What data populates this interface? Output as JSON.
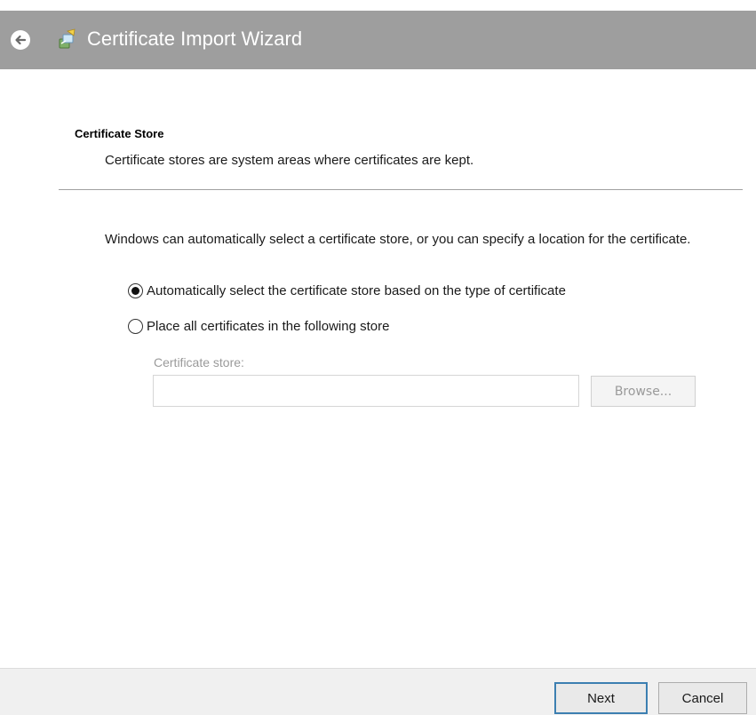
{
  "window": {
    "title": "Certificate Import Wizard",
    "back_icon": "back-arrow-icon",
    "app_icon": "certificate-wizard-icon"
  },
  "header": {
    "section_title": "Certificate Store",
    "section_description": "Certificate stores are system areas where certificates are kept."
  },
  "body": {
    "intro": "Windows can automatically select a certificate store, or you can specify a location for the certificate.",
    "options": [
      {
        "label": "Automatically select the certificate store based on the type of certificate",
        "selected": true
      },
      {
        "label": "Place all certificates in the following store",
        "selected": false
      }
    ],
    "store_label": "Certificate store:",
    "store_value": "",
    "browse_label": "Browse..."
  },
  "footer": {
    "next_label": "Next",
    "cancel_label": "Cancel"
  },
  "colors": {
    "titlebar": "#9e9e9e",
    "accent_border": "#3c7fb1",
    "disabled_text": "#9a9a9a"
  }
}
